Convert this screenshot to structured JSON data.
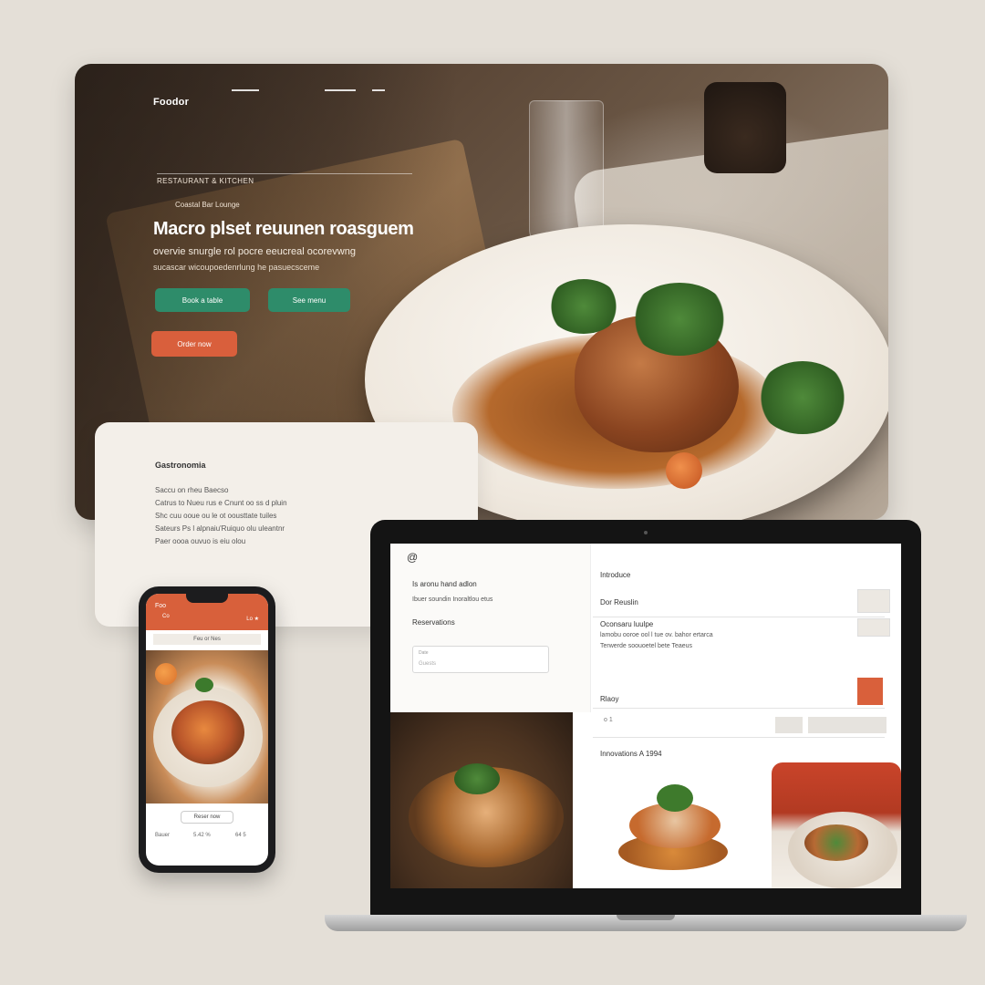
{
  "hero": {
    "logo": "Foodor",
    "eyebrow": "RESTAURANT & KITCHEN",
    "kicker": "Coastal Bar Lounge",
    "title": "Macro plset reuunen roasguem",
    "subtitle": "overvie snurgle rol pocre eeucreal ocorevwng",
    "subtitle2": "sucascar wicoupoedenrlung he pasuecsceme",
    "btn_primary": "Book a table",
    "btn_secondary": "See menu",
    "btn_order": "Order now"
  },
  "info_card": {
    "title": "Gastronomia",
    "lines": [
      "Saccu on rheu Baecso",
      "Catrus to Nueu rus e Cnunt oo ss d pluin",
      "Shc cuu ooue ou le ot  oousttate tuiles",
      "Sateurs Ps l alpnaiu'Ruiquo olu uleantnr",
      "Paer oooa ouvuo is eiu olou"
    ]
  },
  "phone": {
    "logo": "Foo",
    "header_text": "Co",
    "header_right": "Lo ★",
    "subbar": "Feu or Nes",
    "cta": "Reser now",
    "foot_left": "Bauer",
    "foot_mid": "5.42 %",
    "foot_right": "64 5"
  },
  "laptop": {
    "logo": "@",
    "left_heading": "Is aronu hand adlon",
    "left_sub": "Ibuer soundin Inoraltlou etus",
    "section_label": "Reservations",
    "input_label": "Date",
    "input_value": "Guests",
    "right_title": "Introduce",
    "right_item1": "Dor Reuslin",
    "right_item2": "Oconsaru luulpe",
    "right_item2_sub1": "lamobu ooroe ool l tue ov. bahor ertarca",
    "right_item2_sub2": "Terwerde soouoetel bete Teaeus",
    "right_item3": "Rlaoy",
    "right_row4": "o 1",
    "right_section": "Innovations A 1994"
  },
  "colors": {
    "accent_green": "#2e8c6a",
    "accent_orange": "#d95f3c",
    "background": "#e4dfd7"
  }
}
